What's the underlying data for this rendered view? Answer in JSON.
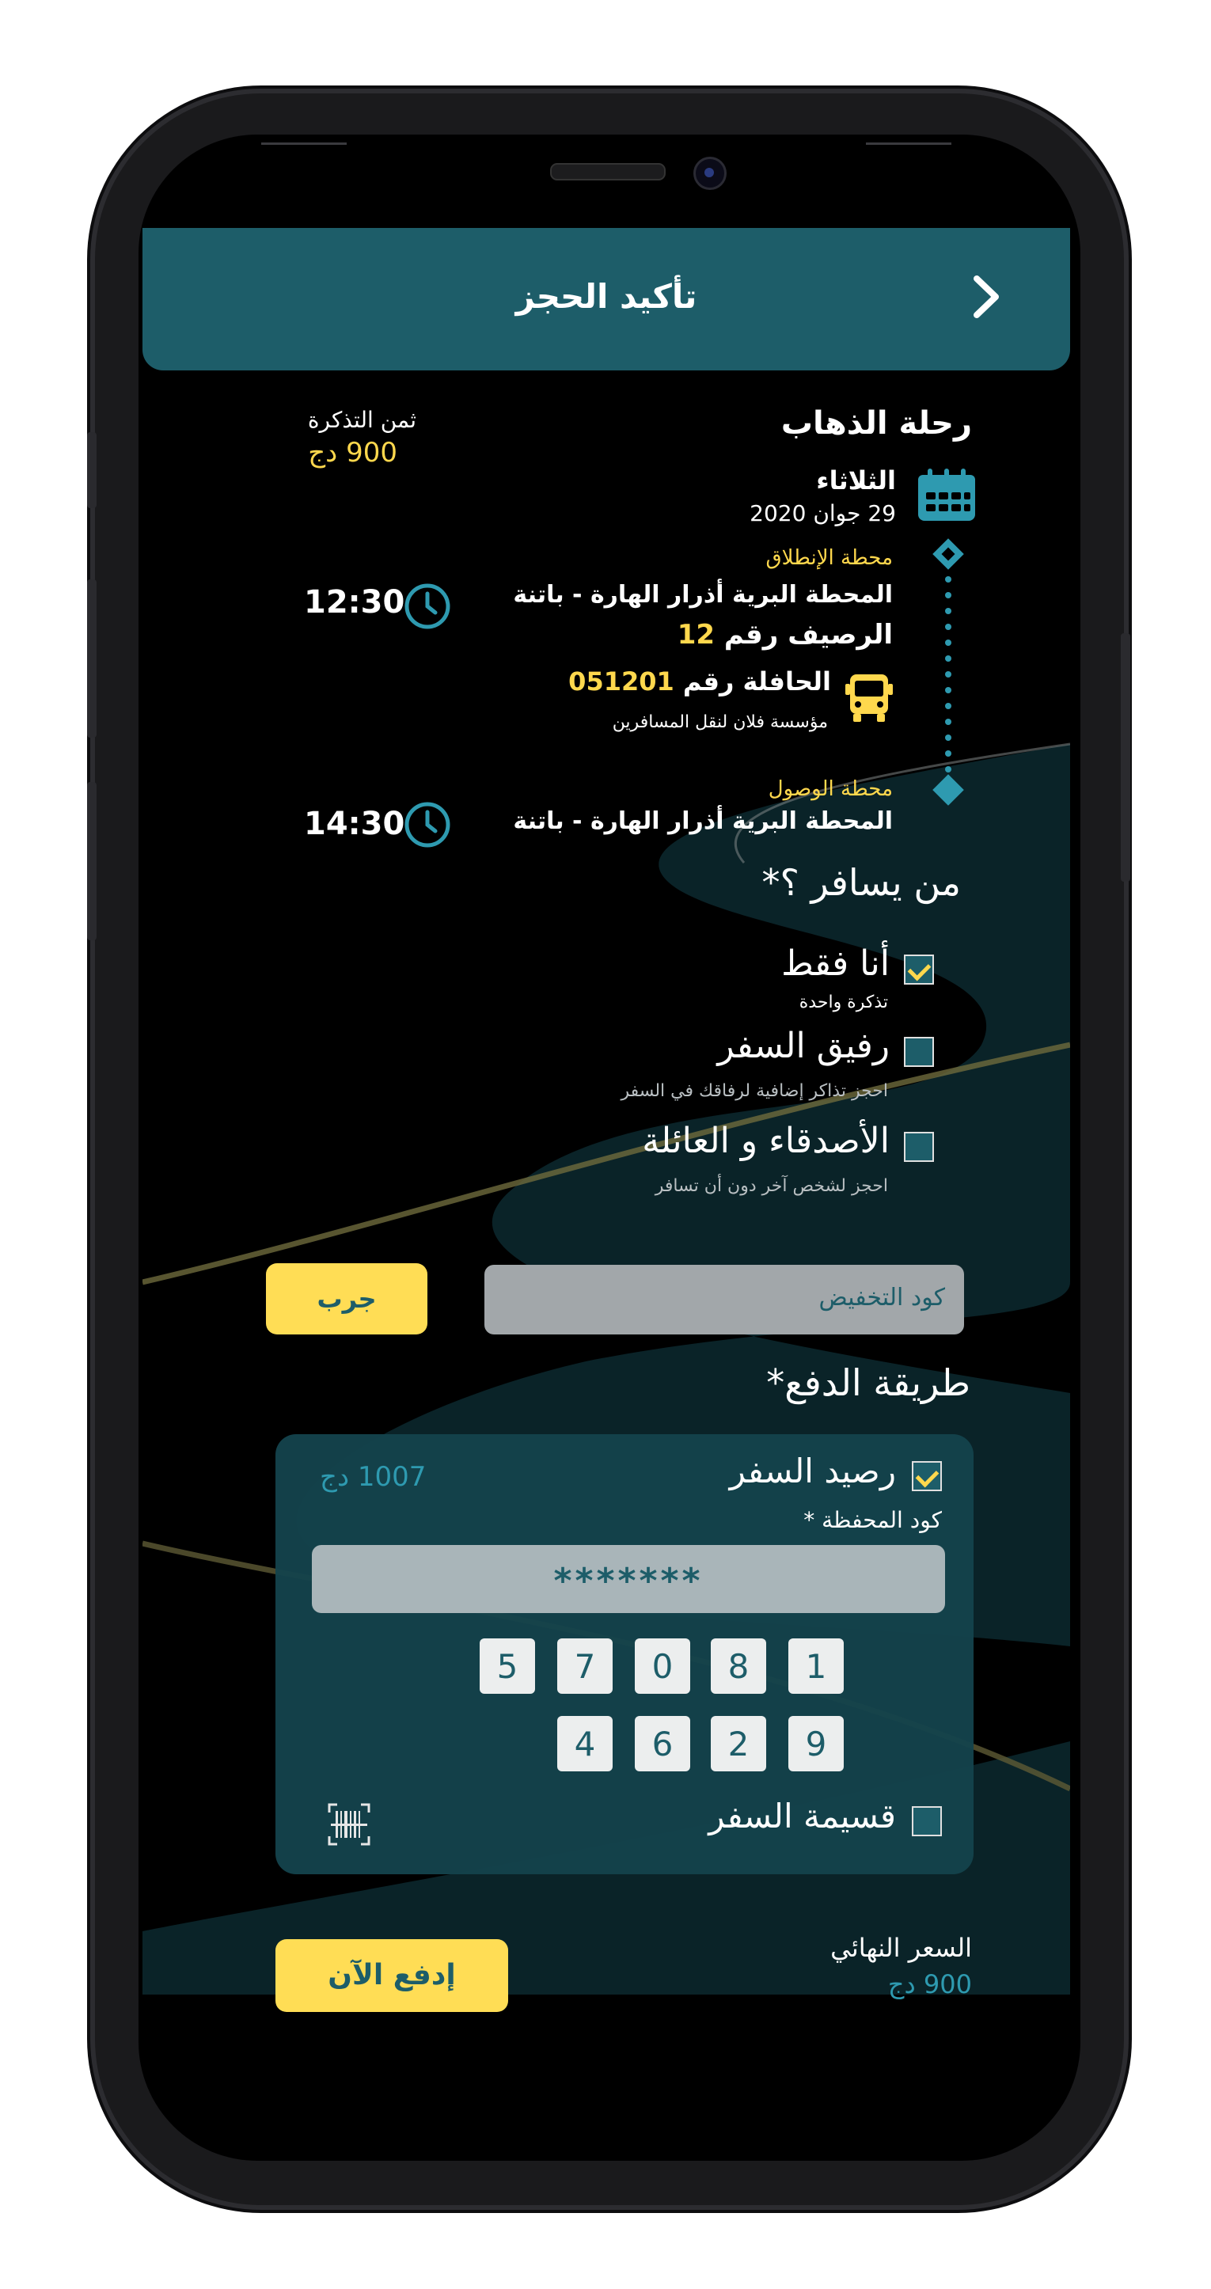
{
  "header": {
    "title": "تأكيد الحجز"
  },
  "trip": {
    "heading": "رحلة الذهاب",
    "day": "الثلاثاء",
    "date": "29 جوان 2020",
    "price_label": "ثمن التذكرة",
    "price_value": "900 دج",
    "departure_label": "محطة الإنطلاق",
    "departure_station": "المحطة البرية أذرار الهارة - باتنة",
    "departure_time": "12:30",
    "platform_label": "الرصيف رقم",
    "platform_number": "12",
    "bus_label": "الحافلة رقم",
    "bus_number": "051201",
    "company": "مؤسسة فلان لنقل المسافرين",
    "arrival_label": "محطة الوصول",
    "arrival_station": "المحطة البرية أذرار الهارة - باتنة",
    "arrival_time": "14:30"
  },
  "travelers": {
    "heading": "من يسافر ؟*",
    "options": [
      {
        "label": "أنا فقط",
        "sub": "تذكرة واحدة",
        "checked": true
      },
      {
        "label": "رفيق السفر",
        "sub": "احجز تذاكر إضافية لرفاقك في السفر",
        "checked": false
      },
      {
        "label": "الأصدقاء و العائلة",
        "sub": "احجز لشخص آخر دون أن تسافر",
        "checked": false
      }
    ]
  },
  "discount": {
    "placeholder": "كود التخفيض",
    "try_label": "جرب"
  },
  "payment": {
    "heading": "طريقة الدفع*",
    "wallet_label": "رصيد السفر",
    "wallet_balance": "1007 دج",
    "wallet_code_label": "كود المحفظة *",
    "wallet_code_value": "*******",
    "keypad_row1": [
      "1",
      "8",
      "0",
      "7",
      "5"
    ],
    "keypad_row2": [
      "9",
      "2",
      "6",
      "4"
    ],
    "voucher_label": "قسيمة السفر"
  },
  "footer": {
    "final_price_label": "السعر النهائي",
    "final_price_value": "900 دج",
    "pay_label": "إدفع الآن"
  },
  "colors": {
    "teal": "#1d5d69",
    "accent_yellow": "#ffd84d",
    "link_teal": "#2e9ab0"
  }
}
